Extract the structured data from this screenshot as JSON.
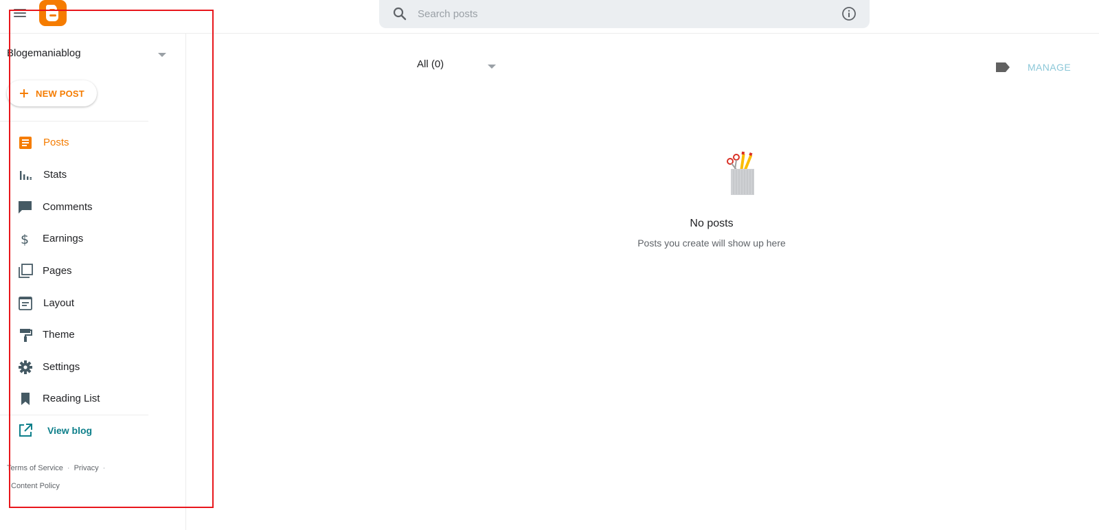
{
  "header": {
    "search_placeholder": "Search posts"
  },
  "sidebar": {
    "blog_name": "Blogemaniablog",
    "new_post_label": "NEW POST",
    "items": [
      {
        "label": "Posts",
        "icon": "posts-icon",
        "active": true
      },
      {
        "label": "Stats",
        "icon": "stats-icon"
      },
      {
        "label": "Comments",
        "icon": "comments-icon"
      },
      {
        "label": "Earnings",
        "icon": "dollar-icon"
      },
      {
        "label": "Pages",
        "icon": "pages-icon"
      },
      {
        "label": "Layout",
        "icon": "layout-icon"
      },
      {
        "label": "Theme",
        "icon": "paint-roller-icon"
      },
      {
        "label": "Settings",
        "icon": "gear-icon"
      },
      {
        "label": "Reading List",
        "icon": "bookmark-icon"
      }
    ],
    "view_blog_label": "View blog",
    "footer": {
      "terms": "Terms of Service",
      "privacy": "Privacy",
      "content_policy": "Content Policy"
    }
  },
  "main": {
    "filter_label": "All (0)",
    "manage_label": "MANAGE",
    "empty_title": "No posts",
    "empty_subtitle": "Posts you create will show up here"
  },
  "colors": {
    "accent": "#f57c00",
    "link": "#0d7f8a",
    "manage": "#8bc7d8",
    "highlight": "#e8151b"
  }
}
